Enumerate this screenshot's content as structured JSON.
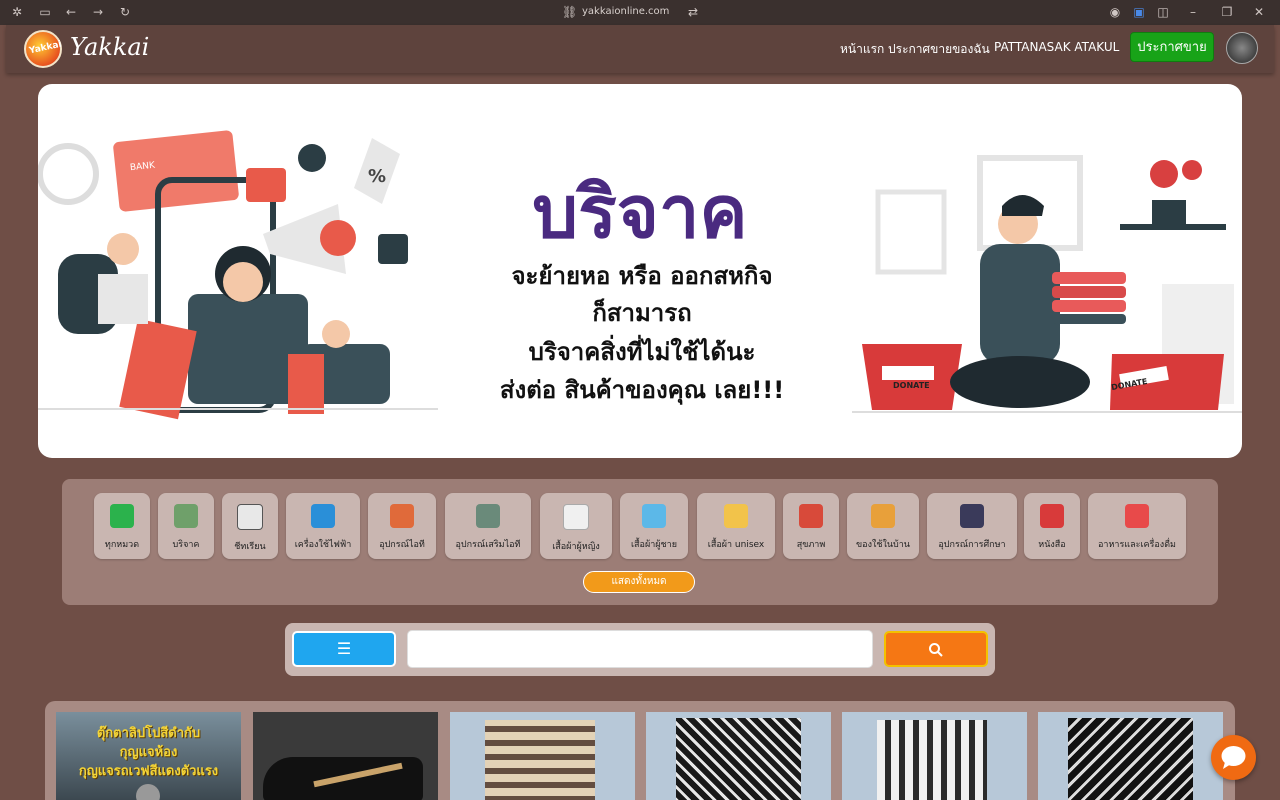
{
  "browser": {
    "url": "yakkaionline.com"
  },
  "header": {
    "brand": "Yakkai",
    "logo_text": "Yakkai",
    "nav": [
      "หน้าแรก",
      "ประกาศขายของฉัน",
      "PATTANASAK ATAKUL"
    ],
    "post_button": "ประกาศขาย"
  },
  "banner": {
    "title": "บริจาค",
    "lines": [
      "จะย้ายหอ หรือ ออกสหกิจ",
      "ก็สามารถ",
      "บริจาคสิ่งที่ไม่ใช้ได้นะ",
      "ส่งต่อ สินค้าของคุณ เลย!!!"
    ],
    "tags": [
      "BANK",
      "DONATE",
      "DONATE",
      "%"
    ]
  },
  "categories": [
    {
      "label": "ทุกหมวด",
      "icon": "checkbox-icon",
      "color": "#2bb24c"
    },
    {
      "label": "บริจาค",
      "icon": "donate-box-icon",
      "color": "#6fa06a"
    },
    {
      "label": "ชีทเรียน",
      "icon": "notebook-icon",
      "color": "#e8e8e8"
    },
    {
      "label": "เครื่องใช้ไฟฟ้า",
      "icon": "appliance-icon",
      "color": "#2a8fd8"
    },
    {
      "label": "อุปกรณ์ไอที",
      "icon": "laptop-icon",
      "color": "#e06a3a"
    },
    {
      "label": "อุปกรณ์เสริมไอที",
      "icon": "usb-icon",
      "color": "#6a8a7a"
    },
    {
      "label": "เสื้อผ้าผู้หญิง",
      "icon": "dress-icon",
      "color": "#f0f0f0"
    },
    {
      "label": "เสื้อผ้าผู้ชาย",
      "icon": "tshirt-icon",
      "color": "#5cb8e8"
    },
    {
      "label": "เสื้อผ้า unisex",
      "icon": "shirt-icon",
      "color": "#f2c34a"
    },
    {
      "label": "สุขภาพ",
      "icon": "exercise-icon",
      "color": "#d84a3a"
    },
    {
      "label": "ของใช้ในบ้าน",
      "icon": "home-goods-icon",
      "color": "#e8a03a"
    },
    {
      "label": "อุปกรณ์การศึกษา",
      "icon": "graduation-icon",
      "color": "#3a3a5a"
    },
    {
      "label": "หนังสือ",
      "icon": "book-icon",
      "color": "#d83a3a"
    },
    {
      "label": "อาหารและเครื่องดื่ม",
      "icon": "snack-icon",
      "color": "#e84a4a"
    }
  ],
  "show_all": "แสดงทั้งหมด",
  "search": {
    "placeholder": "",
    "filter_icon": "indent-icon",
    "search_icon": "magnifier-icon"
  },
  "products": [
    {
      "text_lines": [
        "ตุ๊กตาลิปโปสีดำกับ",
        "กุญแจห้อง",
        "กุญแจรถเวฟสีแดงตัวแรง"
      ],
      "type": "keys"
    },
    {
      "text_lines": [],
      "type": "shoes"
    },
    {
      "text_lines": [],
      "type": "plaid-shorts"
    },
    {
      "text_lines": [],
      "type": "patterned-pants"
    },
    {
      "text_lines": [],
      "type": "plaid-shorts"
    },
    {
      "text_lines": [],
      "type": "elephant-pants"
    }
  ]
}
